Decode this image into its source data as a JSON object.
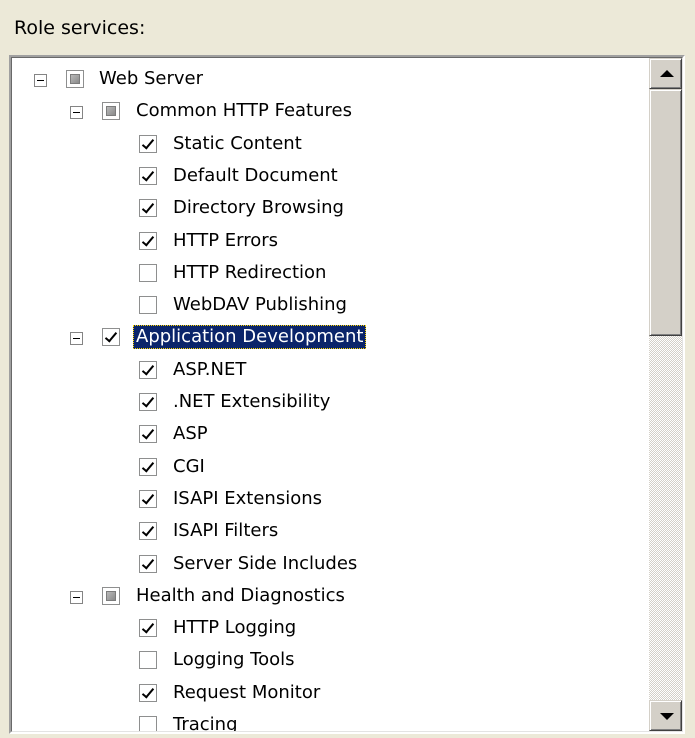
{
  "section_label": "Role services:",
  "tree": [
    {
      "label": "Web Server",
      "level": 0,
      "expander": true,
      "state": "indeterminate",
      "selected": false
    },
    {
      "label": "Common HTTP Features",
      "level": 1,
      "expander": true,
      "state": "indeterminate",
      "selected": false
    },
    {
      "label": "Static Content",
      "level": 2,
      "expander": false,
      "state": "checked",
      "selected": false
    },
    {
      "label": "Default Document",
      "level": 2,
      "expander": false,
      "state": "checked",
      "selected": false
    },
    {
      "label": "Directory Browsing",
      "level": 2,
      "expander": false,
      "state": "checked",
      "selected": false
    },
    {
      "label": "HTTP Errors",
      "level": 2,
      "expander": false,
      "state": "checked",
      "selected": false
    },
    {
      "label": "HTTP Redirection",
      "level": 2,
      "expander": false,
      "state": "unchecked",
      "selected": false
    },
    {
      "label": "WebDAV Publishing",
      "level": 2,
      "expander": false,
      "state": "unchecked",
      "selected": false
    },
    {
      "label": "Application Development",
      "level": 1,
      "expander": true,
      "state": "checked",
      "selected": true
    },
    {
      "label": "ASP.NET",
      "level": 2,
      "expander": false,
      "state": "checked",
      "selected": false
    },
    {
      "label": ".NET Extensibility",
      "level": 2,
      "expander": false,
      "state": "checked",
      "selected": false
    },
    {
      "label": "ASP",
      "level": 2,
      "expander": false,
      "state": "checked",
      "selected": false
    },
    {
      "label": "CGI",
      "level": 2,
      "expander": false,
      "state": "checked",
      "selected": false
    },
    {
      "label": "ISAPI Extensions",
      "level": 2,
      "expander": false,
      "state": "checked",
      "selected": false
    },
    {
      "label": "ISAPI Filters",
      "level": 2,
      "expander": false,
      "state": "checked",
      "selected": false
    },
    {
      "label": "Server Side Includes",
      "level": 2,
      "expander": false,
      "state": "checked",
      "selected": false
    },
    {
      "label": "Health and Diagnostics",
      "level": 1,
      "expander": true,
      "state": "indeterminate",
      "selected": false
    },
    {
      "label": "HTTP Logging",
      "level": 2,
      "expander": false,
      "state": "checked",
      "selected": false
    },
    {
      "label": "Logging Tools",
      "level": 2,
      "expander": false,
      "state": "unchecked",
      "selected": false
    },
    {
      "label": "Request Monitor",
      "level": 2,
      "expander": false,
      "state": "checked",
      "selected": false
    },
    {
      "label": "Tracing",
      "level": 2,
      "expander": false,
      "state": "unchecked",
      "selected": false
    }
  ],
  "scrollbar": {
    "up_icon": "arrow-up-icon",
    "down_icon": "arrow-down-icon"
  },
  "colors": {
    "dialog_background": "#ECE9D8",
    "tree_background": "#FFFFFF",
    "selection_background": "#0A246A",
    "selection_text": "#FFFFFF"
  }
}
